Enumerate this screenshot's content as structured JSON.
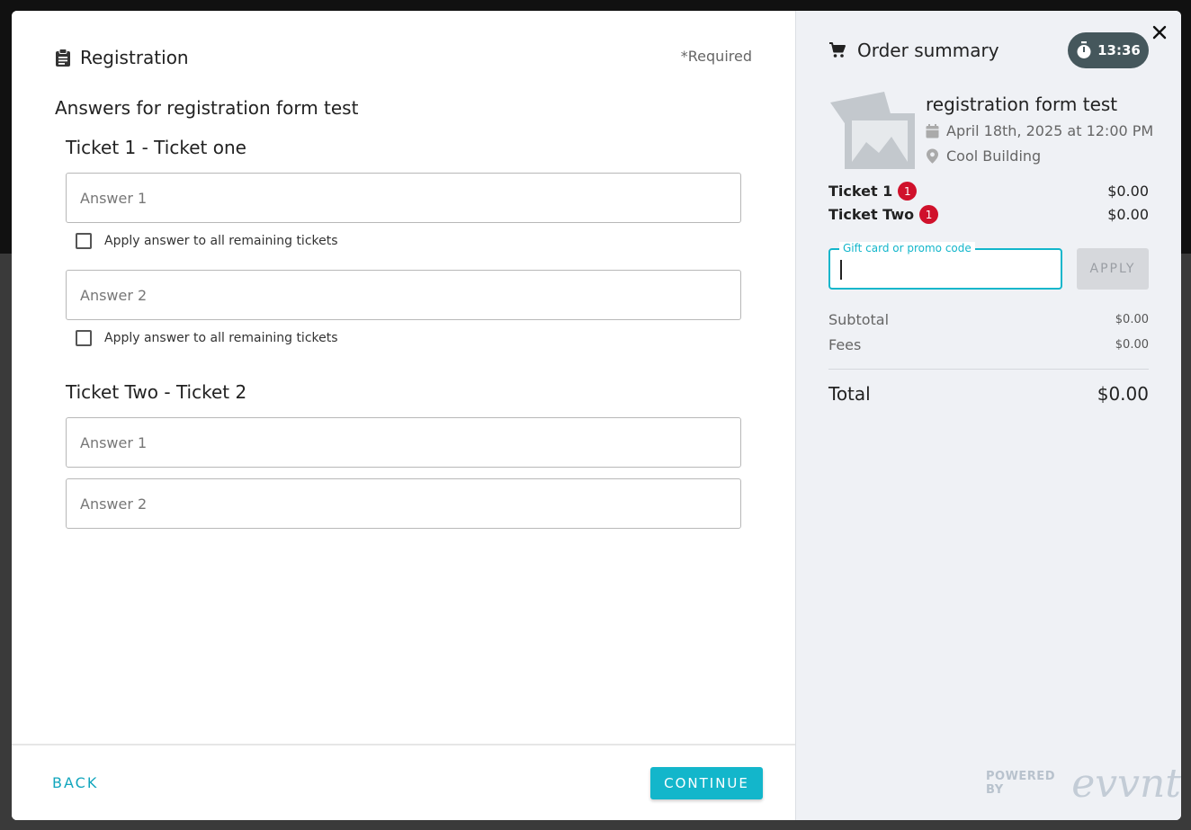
{
  "registration": {
    "title": "Registration",
    "required_note": "*Required",
    "answers_heading": "Answers for registration form test",
    "tickets": [
      {
        "title": "Ticket 1 - Ticket one",
        "fields": [
          {
            "placeholder": "Answer 1",
            "value": "",
            "apply_label": "Apply answer to all remaining tickets",
            "apply_checked": false
          },
          {
            "placeholder": "Answer 2",
            "value": "",
            "apply_label": "Apply answer to all remaining tickets",
            "apply_checked": false
          }
        ]
      },
      {
        "title": "Ticket Two - Ticket 2",
        "fields": [
          {
            "placeholder": "Answer 1",
            "value": ""
          },
          {
            "placeholder": "Answer 2",
            "value": ""
          }
        ]
      }
    ]
  },
  "footer": {
    "back_label": "BACK",
    "continue_label": "CONTINUE"
  },
  "summary": {
    "title": "Order summary",
    "timer": "13:36",
    "event": {
      "name": "registration form test",
      "date": "April 18th, 2025 at 12:00 PM",
      "location": "Cool Building"
    },
    "line_items": [
      {
        "name": "Ticket 1",
        "qty": "1",
        "price": "$0.00"
      },
      {
        "name": "Ticket Two",
        "qty": "1",
        "price": "$0.00"
      }
    ],
    "promo": {
      "label": "Gift card or promo code",
      "value": "",
      "apply_label": "APPLY"
    },
    "subtotal_label": "Subtotal",
    "subtotal_value": "$0.00",
    "fees_label": "Fees",
    "fees_value": "$0.00",
    "total_label": "Total",
    "total_value": "$0.00"
  },
  "branding": {
    "powered_by": "POWERED BY",
    "logo_text": "evvnt"
  },
  "colors": {
    "accent": "#13b6cb",
    "badge": "#d0112b",
    "timer_bg": "#45575c"
  }
}
